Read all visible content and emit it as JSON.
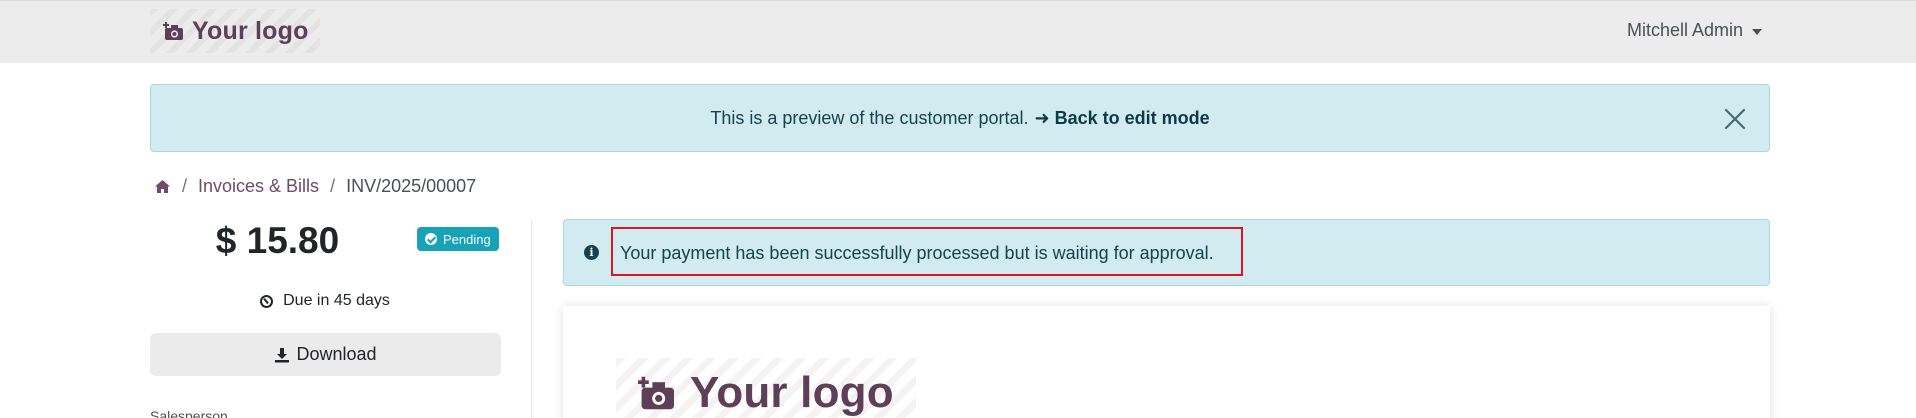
{
  "header": {
    "logo_text": "Your logo",
    "user_name": "Mitchell Admin"
  },
  "preview_banner": {
    "message": "This is a preview of the customer portal.",
    "link_label": "➜ Back to edit mode"
  },
  "breadcrumb": {
    "items": [
      "Invoices & Bills",
      "INV/2025/00007"
    ]
  },
  "invoice": {
    "amount": "$ 15.80",
    "status": "Pending",
    "due": "Due in 45 days",
    "download_label": "Download",
    "salesperson_label": "Salesperson"
  },
  "alert": {
    "message": "Your payment has been successfully processed but is waiting for approval."
  },
  "document": {
    "logo_text": "Your logo"
  },
  "colors": {
    "brand": "#714b67",
    "info_bg": "#d1ebf1",
    "badge": "#17a2b8",
    "highlight": "#e0141e"
  },
  "icons": [
    "camera-plus-icon",
    "caret-down-icon",
    "close-icon",
    "home-icon",
    "check-circle-icon",
    "clock-icon",
    "download-icon",
    "info-icon"
  ]
}
